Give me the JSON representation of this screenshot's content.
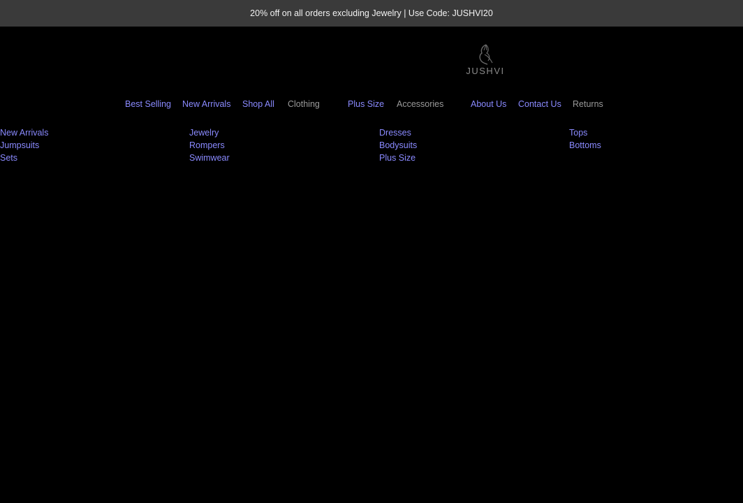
{
  "announcement": {
    "text": "20% off on all orders excluding Jewelry | Use Code: JUSHVI20"
  },
  "logo": {
    "text": "JUSHVI",
    "icon": "butterfly-logo-icon"
  },
  "nav": {
    "best_selling": "Best Selling",
    "new_arrivals": "New Arrivals",
    "shop_all": "Shop All",
    "clothing": "Clothing",
    "plus_size": "Plus Size",
    "accessories": "Accessories",
    "about_us": "About Us",
    "contact_us": "Contact Us",
    "returns": "Returns"
  },
  "submenu": {
    "new_arrivals": "New Arrivals",
    "jumpsuits": "Jumpsuits",
    "sets": "Sets",
    "jewelry": "Jewelry",
    "rompers": "Rompers",
    "swimwear": "Swimwear",
    "dresses": "Dresses",
    "bodysuits": "Bodysuits",
    "plus_size": "Plus Size",
    "tops": "Tops",
    "bottoms": "Bottoms"
  },
  "colors": {
    "background": "#000000",
    "announcement_bg": "#3a3a3a",
    "link": "#8a8aff",
    "plain_text": "#9a9a9a"
  }
}
